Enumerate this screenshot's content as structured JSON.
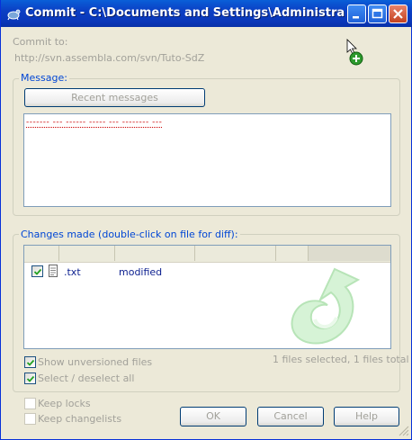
{
  "window": {
    "title": "Commit - C:\\Documents and Settings\\Administrateur\\M..."
  },
  "commit_to": {
    "label": "Commit to:",
    "url": "http://svn.assembla.com/svn/Tuto-SdZ"
  },
  "message": {
    "group_label": "Message:",
    "recent_button": "Recent messages",
    "text": "------- --- ------ ----- --- -------- ---"
  },
  "changes": {
    "group_label": "Changes made (double-click on file for diff):",
    "files": [
      {
        "checked": true,
        "name": ".txt",
        "status": "modified"
      }
    ],
    "status_line": "1 files selected, 1 files total",
    "show_unversioned": {
      "label": "Show unversioned files",
      "checked": true
    },
    "select_all": {
      "label": "Select / deselect all",
      "checked": true
    }
  },
  "options": {
    "keep_locks": "Keep locks",
    "keep_changelists": "Keep changelists"
  },
  "buttons": {
    "ok": "OK",
    "cancel": "Cancel",
    "help": "Help"
  },
  "colors": {
    "accent": "#0046d5",
    "spell_error": "#cc0000",
    "title_bar": "#0a37b9"
  }
}
